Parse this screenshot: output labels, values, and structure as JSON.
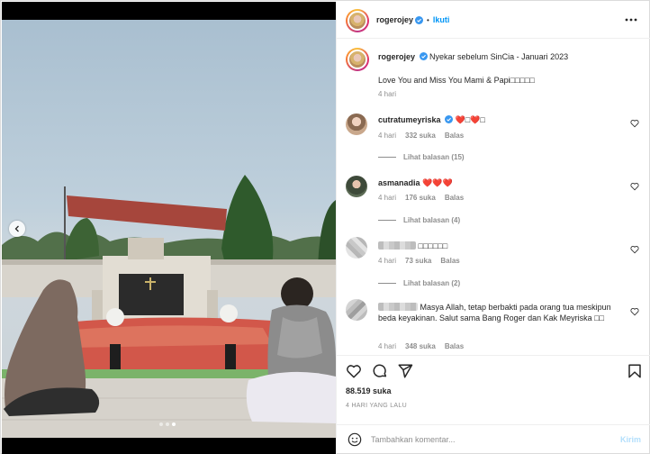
{
  "post": {
    "author": "rogerojey",
    "follow_label": "Ikuti",
    "caption_line1": "Nyekar sebelum SinCia - Januari 2023",
    "caption_line2": "Love You and Miss You Mami & Papi□□□□□",
    "caption_time": "4 hari"
  },
  "comments": [
    {
      "user": "cutratumeyriska",
      "verified": true,
      "text": "❤️□❤️□",
      "time": "4 hari",
      "likes": "332 suka",
      "reply_label": "Balas",
      "view_replies": "Lihat balasan (15)"
    },
    {
      "user": "asmanadia",
      "verified": false,
      "text": "❤️❤️❤️",
      "time": "4 hari",
      "likes": "176 suka",
      "reply_label": "Balas",
      "view_replies": "Lihat balasan (4)"
    },
    {
      "user": "",
      "verified": false,
      "text": "□□□□□□",
      "time": "4 hari",
      "likes": "73 suka",
      "reply_label": "Balas",
      "view_replies": "Lihat balasan (2)"
    },
    {
      "user": "",
      "verified": false,
      "text": "Masya Allah, tetap berbakti pada orang tua meskipun beda keyakinan. Salut sama Bang Roger dan Kak Meyriska □□",
      "time": "4 hari",
      "likes": "348 suka",
      "reply_label": "Balas",
      "view_replies": ""
    }
  ],
  "actions": {
    "like_icon": "heart-icon",
    "comment_icon": "comment-icon",
    "share_icon": "share-icon",
    "save_icon": "bookmark-icon"
  },
  "stats": {
    "likes": "88.519 suka",
    "time_ago": "4 HARI YANG LALU"
  },
  "composer": {
    "placeholder": "Tambahkan komentar...",
    "post_label": "Kirim"
  },
  "carousel": {
    "total": 3,
    "active_index": 2
  },
  "colors": {
    "accent": "#0095f6",
    "post_disabled": "#b2dffc",
    "verified": "#3897f0",
    "meta": "#8e8e8e"
  }
}
